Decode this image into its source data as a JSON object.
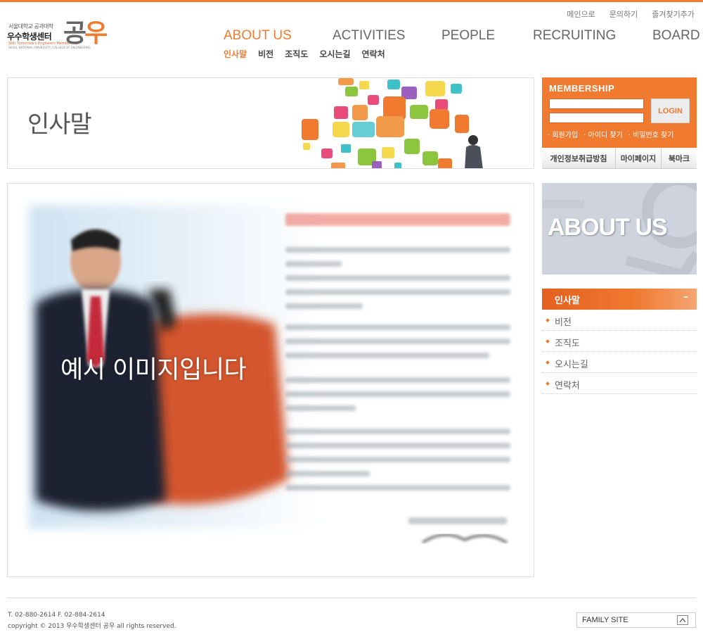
{
  "colors": {
    "accent": "#f07a30",
    "text": "#333333",
    "border": "#dddddd"
  },
  "logo": {
    "subtitle": "서울대학교 공과대학",
    "name": "우수학생센터",
    "tagline": "SNU Tomorrow's Engineers Membership",
    "tagline2": "SEOUL NATIONAL UNIVERSITY, COLLEGE OF ENGINEERING",
    "mark_first": "공",
    "mark_second": "우"
  },
  "util_links": [
    "메인으로",
    "문의하기",
    "즐겨찾기추가"
  ],
  "nav": {
    "items": [
      "ABOUT US",
      "ACTIVITIES",
      "PEOPLE",
      "RECRUITING",
      "BOARD"
    ],
    "active": "ABOUT US",
    "sub_items": [
      "인사말",
      "비전",
      "조직도",
      "오시는길",
      "연락처"
    ]
  },
  "banner": {
    "title": "인사말"
  },
  "content": {
    "image_caption": "예시 이미지입니다"
  },
  "membership": {
    "title": "MEMBERSHIP",
    "login_label": "LOGIN",
    "id_value": "",
    "pw_value": "",
    "links": [
      "· 회원가입",
      "· 아이디 찾기",
      "· 비밀번호 찾기"
    ]
  },
  "quick_links": [
    "개인정보취급방침",
    "마이페이지",
    "북마크"
  ],
  "about_box": {
    "title": "ABOUT US"
  },
  "lnb": {
    "active_label": "인사말",
    "collapse_symbol": "–",
    "items": [
      "비전",
      "조직도",
      "오시는길",
      "연락처"
    ]
  },
  "footer": {
    "contact": "T. 02-880-2614 F. 02-884-2614",
    "copyright": "copyright © 2013 우수학생센터 공우 all rights reserved.",
    "family_site": "FAMILY SITE",
    "family_site_icon": "chevron-up-icon"
  }
}
